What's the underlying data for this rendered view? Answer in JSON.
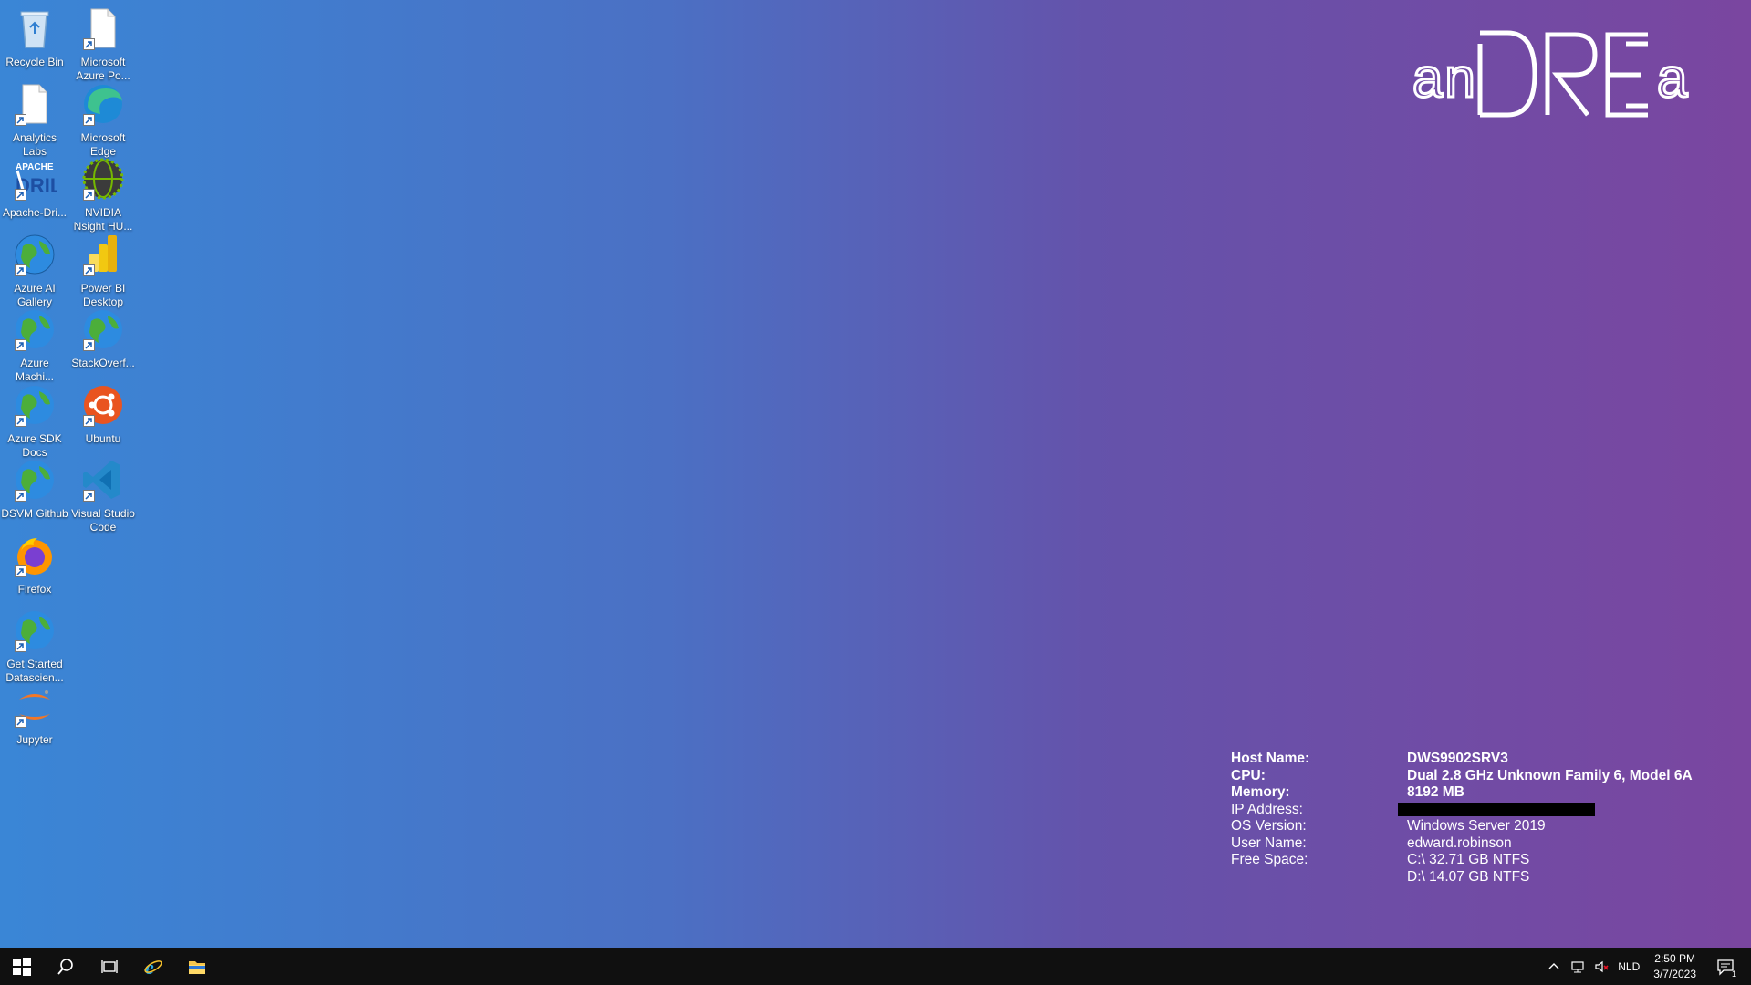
{
  "desktop": {
    "icons": [
      {
        "label": "Recycle Bin",
        "icon": "recycle-bin-icon"
      },
      {
        "label": "Microsoft Azure Po...",
        "icon": "document-icon"
      },
      {
        "label": "Analytics Labs",
        "icon": "document-icon"
      },
      {
        "label": "Microsoft Edge",
        "icon": "edge-icon"
      },
      {
        "label": "Apache-Dri...",
        "icon": "apache-drill-icon"
      },
      {
        "label": "NVIDIA Nsight HU...",
        "icon": "nvidia-nsight-icon"
      },
      {
        "label": "Azure AI Gallery",
        "icon": "globe-icon"
      },
      {
        "label": "Power BI Desktop",
        "icon": "power-bi-icon"
      },
      {
        "label": "Azure Machi...",
        "icon": "globe-icon"
      },
      {
        "label": "StackOverf...",
        "icon": "globe-icon"
      },
      {
        "label": "Azure SDK Docs",
        "icon": "globe-icon"
      },
      {
        "label": "Ubuntu",
        "icon": "ubuntu-icon"
      },
      {
        "label": "DSVM Github",
        "icon": "globe-icon"
      },
      {
        "label": "Visual Studio Code",
        "icon": "vscode-icon"
      },
      {
        "label": "Firefox",
        "icon": "firefox-icon"
      },
      {
        "label": "Get Started Datascien...",
        "icon": "globe-icon"
      },
      {
        "label": "Jupyter",
        "icon": "jupyter-icon"
      }
    ],
    "logo_text": "anDREa"
  },
  "sysinfo": {
    "host_name_label": "Host Name:",
    "host_name": "DWS9902SRV3",
    "cpu_label": "CPU:",
    "cpu": "Dual 2.8 GHz Unknown Family 6, Model 6A",
    "memory_label": "Memory:",
    "memory": "8192 MB",
    "ip_label": "IP Address:",
    "os_label": "OS Version:",
    "os": "Windows Server 2019",
    "user_label": "User Name:",
    "user": "edward.robinson",
    "free_space_label": "Free Space:",
    "free_c": "C:\\ 32.71 GB NTFS",
    "free_d": "D:\\ 14.07 GB NTFS"
  },
  "taskbar": {
    "language": "NLD",
    "time": "2:50 PM",
    "date": "3/7/2023",
    "notification_count": "1"
  }
}
